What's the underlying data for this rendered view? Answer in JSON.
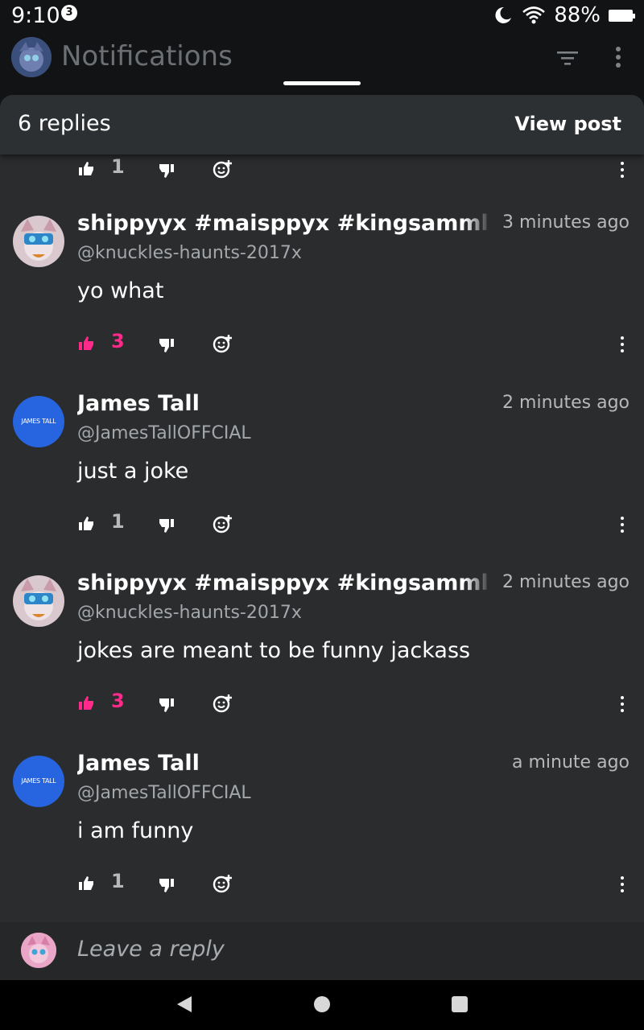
{
  "status_bar": {
    "time": "9:10",
    "notification_count": "3",
    "battery": "88%"
  },
  "header": {
    "title": "Notifications"
  },
  "sheet": {
    "replies_label": "6 replies",
    "view_post_label": "View post"
  },
  "top_actions": {
    "likes": "1",
    "liked": false
  },
  "comments": [
    {
      "author": "shippyyx #maisppyx #kingsammloth",
      "handle": "@knuckles-haunts-2017x",
      "time": "3 minutes ago",
      "body": "yo what",
      "likes": "3",
      "liked": true,
      "avatar": "anime-avatar"
    },
    {
      "author": "James Tall",
      "handle": "@JamesTallOFFCIAL",
      "time": "2 minutes ago",
      "body": "just a joke",
      "likes": "1",
      "liked": false,
      "avatar_text": "JAMES TALL"
    },
    {
      "author": "shippyyx #maisppyx #kingsammloth",
      "handle": "@knuckles-haunts-2017x",
      "time": "2 minutes ago",
      "body": "jokes are meant to be funny jackass",
      "likes": "3",
      "liked": true,
      "avatar": "anime-avatar"
    },
    {
      "author": "James Tall",
      "handle": "@JamesTallOFFCIAL",
      "time": "a minute ago",
      "body": "i am funny",
      "likes": "1",
      "liked": false,
      "avatar_text": "JAMES TALL"
    }
  ],
  "reply": {
    "placeholder": "Leave a reply"
  },
  "colors": {
    "accent_like": "#ff2a8a",
    "sheet_bg": "#2a2c2e",
    "avatar_blue": "#2764e0"
  }
}
